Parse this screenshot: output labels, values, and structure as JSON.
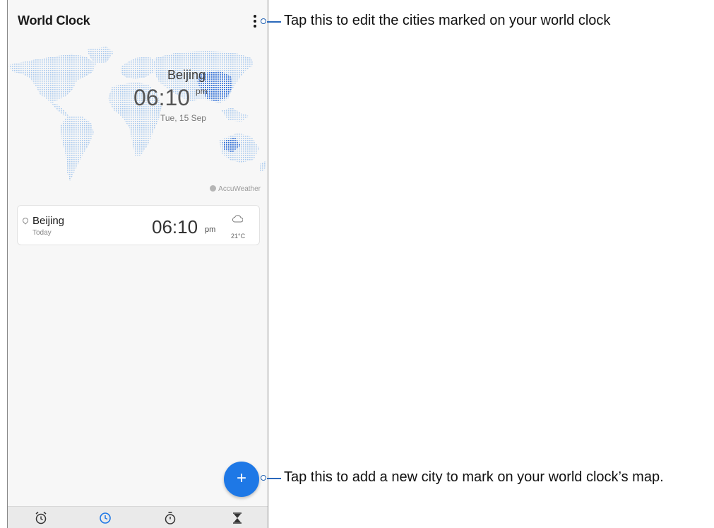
{
  "app": {
    "title": "World Clock"
  },
  "map": {
    "city": "Beijing",
    "time": "06:10",
    "ampm": "pm",
    "date": "Tue, 15 Sep",
    "provider": "AccuWeather"
  },
  "city_card": {
    "city": "Beijing",
    "day": "Today",
    "time": "06:10",
    "ampm": "pm",
    "temperature": "21°C",
    "weather_icon": "cloud-icon"
  },
  "fab": {
    "label": "+"
  },
  "bottom_nav": [
    {
      "name": "alarm",
      "icon": "alarm-clock-icon",
      "active": false
    },
    {
      "name": "world-clock",
      "icon": "clock-icon",
      "active": true
    },
    {
      "name": "stopwatch",
      "icon": "stopwatch-icon",
      "active": false
    },
    {
      "name": "timer",
      "icon": "hourglass-icon",
      "active": false
    }
  ],
  "callouts": {
    "menu": "Tap this to edit the cities marked on your world clock",
    "add": "Tap this to add a new city to mark on your world clock’s map."
  },
  "colors": {
    "accent": "#1e78e6",
    "map_dots": "#a9c9ee",
    "map_highlight": "#2f6fd6",
    "callout_line": "#2a68bb"
  }
}
